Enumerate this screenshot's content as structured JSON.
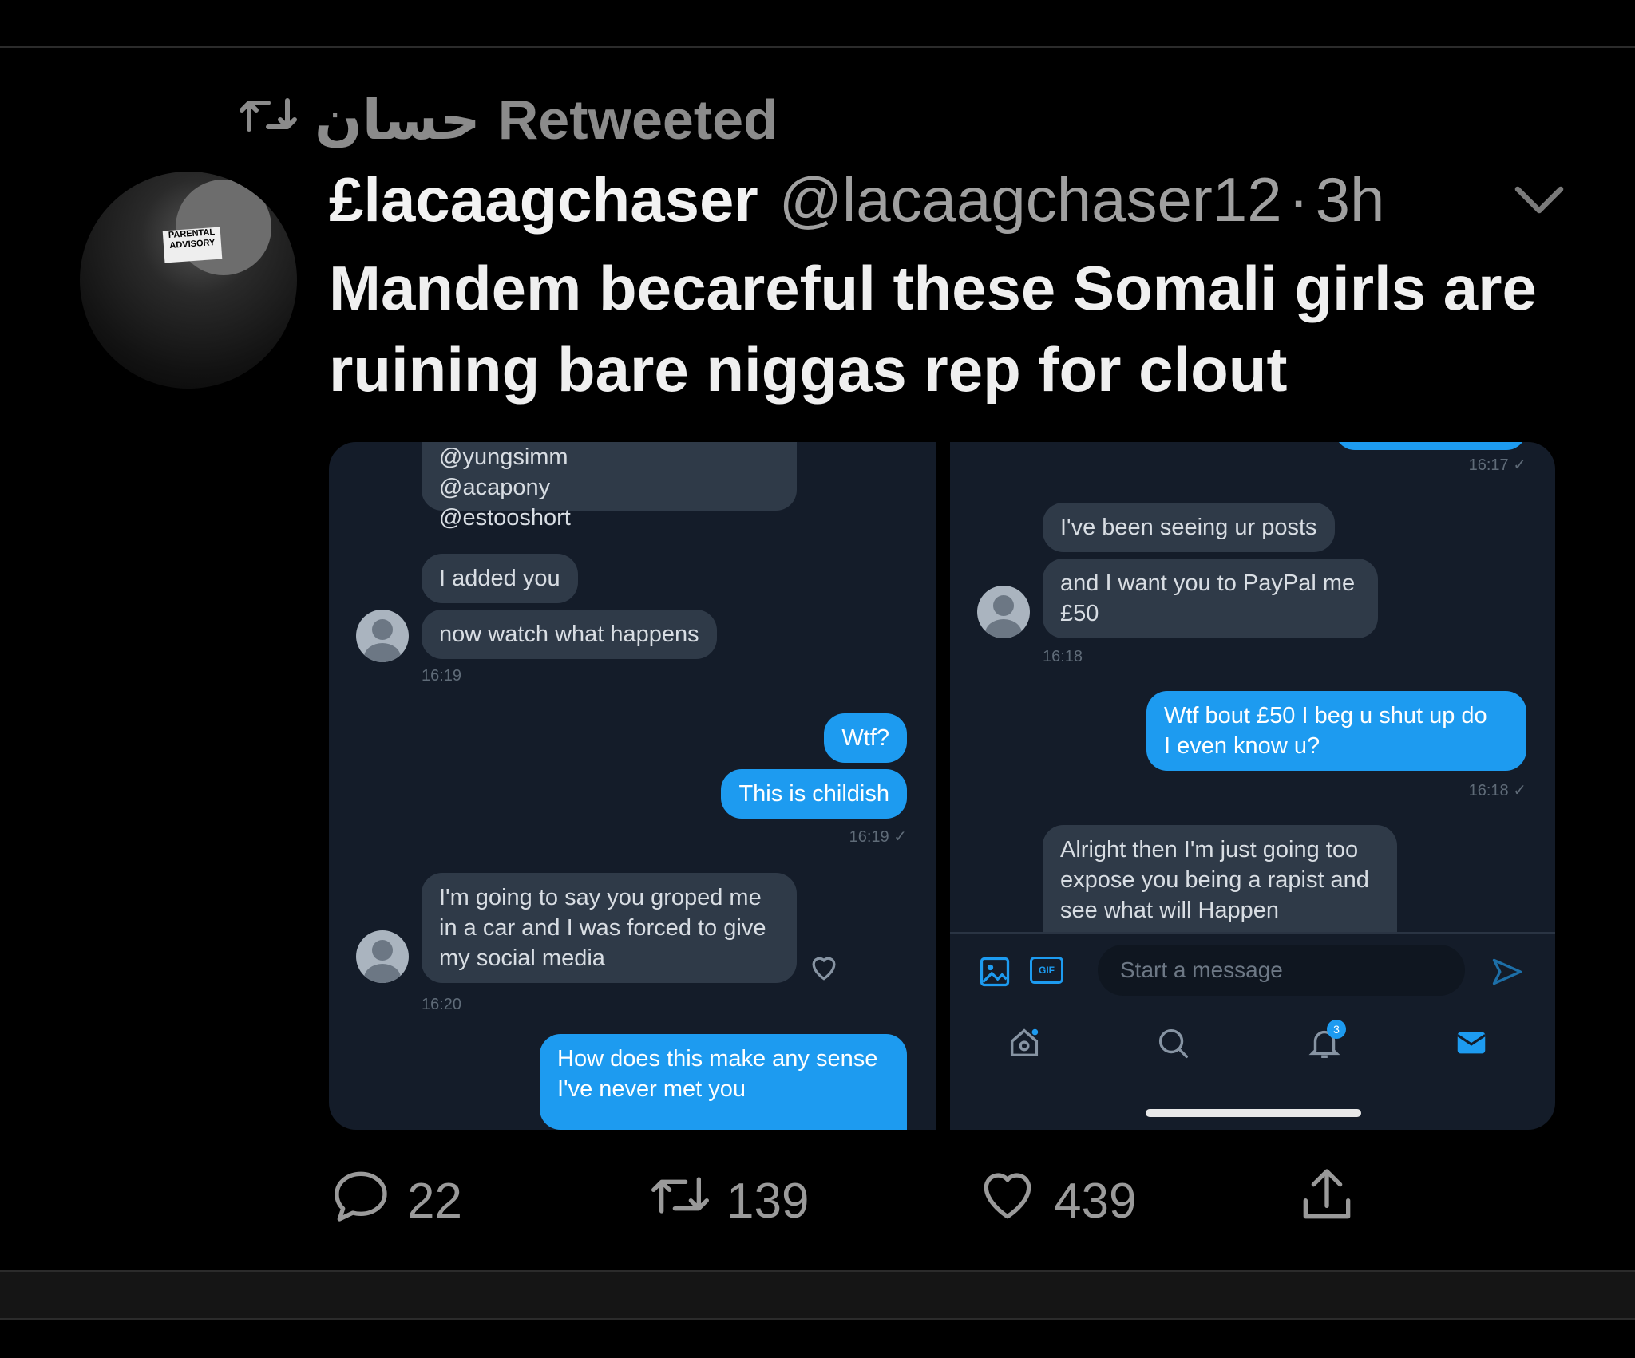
{
  "retweet": {
    "retweeter": "حسان",
    "label": "Retweeted",
    "icon": "retweet-icon"
  },
  "tweet": {
    "display_name": "£lacaagchaser",
    "handle": "@lacaagchaser12",
    "separator": "·",
    "time": "3h",
    "text": "Mandem becareful these Somali girls are ruining bare niggas rep for clout"
  },
  "media": {
    "left_panel": {
      "mentions": [
        "@yungsimm",
        "@acapony",
        "@estooshort"
      ],
      "msg_added": "I added you",
      "msg_watch": "now watch what happens",
      "ts_1": "16:19",
      "out_wtf": "Wtf?",
      "out_childish": "This is childish",
      "ts_2": "16:19 ✓",
      "msg_threat_1": "I'm going to say you groped me",
      "msg_threat_2": "in a car and I was forced to give",
      "msg_threat_3": "my social media",
      "ts_3": "16:20",
      "out_sense_1": "How does this make any sense",
      "out_sense_2": "I've never met you"
    },
    "right_panel": {
      "ts_top": "16:17 ✓",
      "msg_posts": "I've been seeing ur posts",
      "msg_paypal_1": "and I want you to PayPal me",
      "msg_paypal_2": "£50",
      "ts_1": "16:18",
      "out_50_1": "Wtf bout £50 I beg u shut up do",
      "out_50_2": "I even know u?",
      "ts_2": "16:18 ✓",
      "msg_expose_1": "Alright then I'm just going too",
      "msg_expose_2": "expose you being a rapist and",
      "msg_expose_3": "see what will Happen",
      "input_placeholder": "Start a message",
      "gif_label": "GIF",
      "notif_count": "3"
    }
  },
  "actions": {
    "replies": "22",
    "retweets": "139",
    "likes": "439"
  },
  "colors": {
    "background": "#000000",
    "accent": "#1d9bf0",
    "muted": "#8b8b8b"
  }
}
